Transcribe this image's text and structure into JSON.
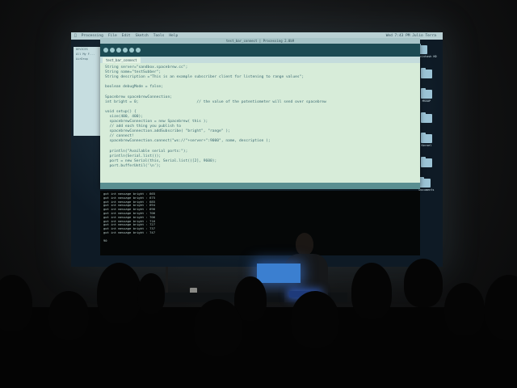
{
  "scene": "projector presentation of code editor",
  "menubar": {
    "app": "Processing",
    "items": [
      "File",
      "Edit",
      "Sketch",
      "Tools",
      "Help"
    ],
    "right_text": "Wed 7:43 PM   Julio Terra"
  },
  "editor": {
    "title": "test_bar_connect | Processing 2.0b9",
    "tab": "test_bar_connect",
    "code_lines": [
      "String server=\"sandbox.spacebrew.cc\";",
      "String name=\"testSubber\";",
      "String description =\"This is an example subscriber client for listening to range values\";",
      "",
      "boolean debugMode = false;",
      "",
      "Spacebrew spacebrewConnection;",
      "int bright = 0;                          // the value of the potentiometer will send over spacebrew",
      "",
      "void setup() {",
      "  size(400, 400);",
      "  spacebrewConnection = new Spacebrew( this );",
      "  // add each thing you publish to",
      "  spacebrewConnection.addSubscribe( \"bright\", \"range\" );",
      "  // connect!",
      "  spacebrewConnection.connect(\"ws://\"+server+\":9000\", name, description );",
      "",
      "  println(\"Available serial ports:\");",
      "  println(Serial.list());",
      "  port = new Serial(this, Serial.list()[2], 9600);",
      "  port.bufferUntil('\\n');"
    ]
  },
  "console": {
    "lines": [
      "got int message bright : 665",
      "got int message bright : 675",
      "got int message bright : 685",
      "got int message bright : 694",
      "got int message bright : 696",
      "got int message bright : 706",
      "got int message bright : 706",
      "got int message bright : 716",
      "got int message bright : 727",
      "got int message bright : 737",
      "got int message bright : 747",
      "",
      "90"
    ]
  },
  "desktop_icons": [
    "Macintosh HD",
    "",
    "MSSOP",
    "",
    "Kernel",
    "",
    "Documents"
  ],
  "finder_items": [
    "DEVICES",
    "All My F...",
    "AirDrop"
  ]
}
